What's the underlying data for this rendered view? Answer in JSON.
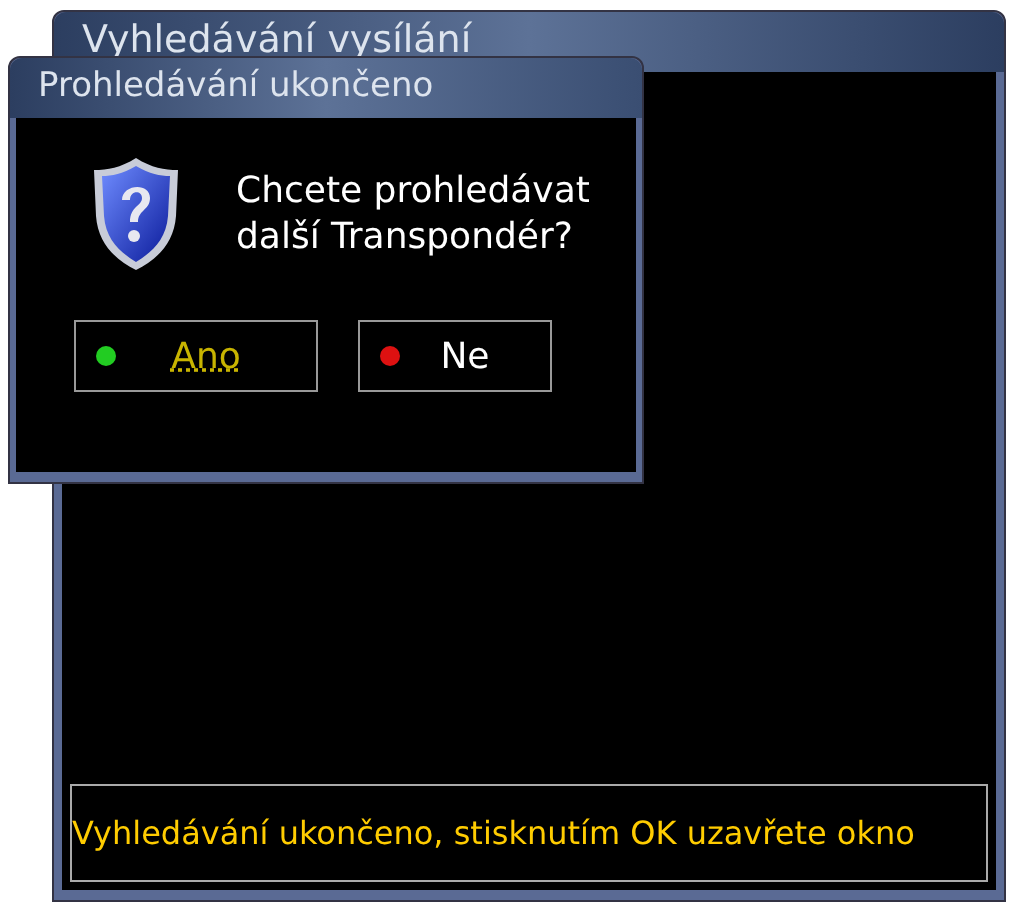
{
  "window": {
    "title": "Vyhledávání vysílání",
    "status": "Vyhledávání ukončeno, stisknutím OK uzavřete okno"
  },
  "dialog": {
    "title": "Prohledávání ukončeno",
    "message": "Chcete prohledávat další Transpondér?",
    "buttons": [
      {
        "label": "Ano",
        "color": "#22cc22",
        "selected": true
      },
      {
        "label": "Ne",
        "color": "#dd1111",
        "selected": false
      }
    ]
  }
}
